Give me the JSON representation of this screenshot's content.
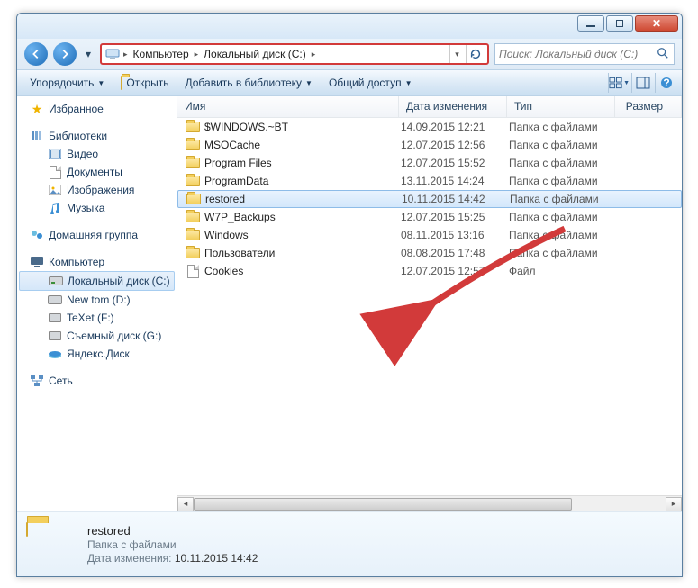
{
  "titlebar": {},
  "nav": {
    "breadcrumb": [
      "Компьютер",
      "Локальный диск (C:)"
    ],
    "search_placeholder": "Поиск: Локальный диск (C:)"
  },
  "toolbar": {
    "organize": "Упорядочить",
    "open": "Открыть",
    "add_library": "Добавить в библиотеку",
    "share": "Общий доступ"
  },
  "tree": {
    "favorites": "Избранное",
    "libraries": "Библиотеки",
    "lib_items": [
      "Видео",
      "Документы",
      "Изображения",
      "Музыка"
    ],
    "homegroup": "Домашняя группа",
    "computer": "Компьютер",
    "drives": [
      "Локальный диск (C:)",
      "New tom (D:)",
      "TeXet (F:)",
      "Съемный диск (G:)",
      "Яндекс.Диск"
    ],
    "network": "Сеть"
  },
  "columns": {
    "name": "Имя",
    "date": "Дата изменения",
    "type": "Тип",
    "size": "Размер"
  },
  "rows": [
    {
      "name": "$WINDOWS.~BT",
      "date": "14.09.2015 12:21",
      "type": "Папка с файлами",
      "icon": "folder"
    },
    {
      "name": "MSOCache",
      "date": "12.07.2015 12:56",
      "type": "Папка с файлами",
      "icon": "folder"
    },
    {
      "name": "Program Files",
      "date": "12.07.2015 15:52",
      "type": "Папка с файлами",
      "icon": "folder"
    },
    {
      "name": "ProgramData",
      "date": "13.11.2015 14:24",
      "type": "Папка с файлами",
      "icon": "folder"
    },
    {
      "name": "restored",
      "date": "10.11.2015 14:42",
      "type": "Папка с файлами",
      "icon": "folder",
      "selected": true
    },
    {
      "name": "W7P_Backups",
      "date": "12.07.2015 15:25",
      "type": "Папка с файлами",
      "icon": "folder"
    },
    {
      "name": "Windows",
      "date": "08.11.2015 13:16",
      "type": "Папка с файлами",
      "icon": "folder"
    },
    {
      "name": "Пользователи",
      "date": "08.08.2015 17:48",
      "type": "Папка с файлами",
      "icon": "folder"
    },
    {
      "name": "Cookies",
      "date": "12.07.2015 12:57",
      "type": "Файл",
      "icon": "file"
    }
  ],
  "details": {
    "name": "restored",
    "type": "Папка с файлами",
    "date_label": "Дата изменения:",
    "date_value": "10.11.2015 14:42"
  }
}
